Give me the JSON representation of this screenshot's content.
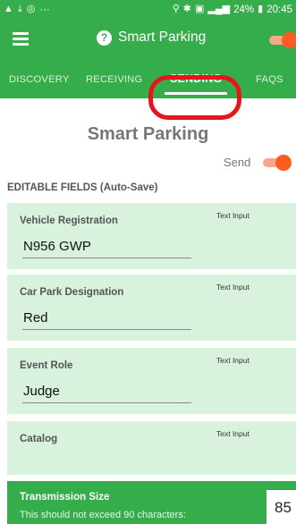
{
  "status_bar": {
    "left_icons": [
      "warning-icon",
      "download-icon",
      "instagram-icon"
    ],
    "more": "···",
    "battery_percent": "24%",
    "time": "20:45"
  },
  "app_bar": {
    "title": "Smart Parking",
    "help_icon": "?",
    "master_toggle_on": true
  },
  "tabs": [
    {
      "label": "DISCOVERY",
      "active": false
    },
    {
      "label": "RECEIVING",
      "active": false
    },
    {
      "label": "SENDING",
      "active": true
    },
    {
      "label": "FAQS",
      "active": false
    }
  ],
  "page": {
    "heading": "Smart Parking",
    "send_label": "Send",
    "send_on": true,
    "section_label": "EDITABLE FIELDS (Auto-Save)"
  },
  "fields": [
    {
      "label": "Vehicle Registration",
      "type": "Text Input",
      "value": "N956 GWP"
    },
    {
      "label": "Car Park Designation",
      "type": "Text Input",
      "value": "Red"
    },
    {
      "label": "Event Role",
      "type": "Text Input",
      "value": "Judge"
    },
    {
      "label": "Catalog",
      "type": "Text Input",
      "value": ""
    }
  ],
  "transmission": {
    "title": "Transmission Size",
    "hint": "This should not exceed 90 characters:",
    "count": "85"
  },
  "colors": {
    "primary_green": "#35ad4a",
    "card_green": "#d9f2dd",
    "toggle_orange": "#ff5a1f",
    "highlight_red": "#e8141b"
  }
}
